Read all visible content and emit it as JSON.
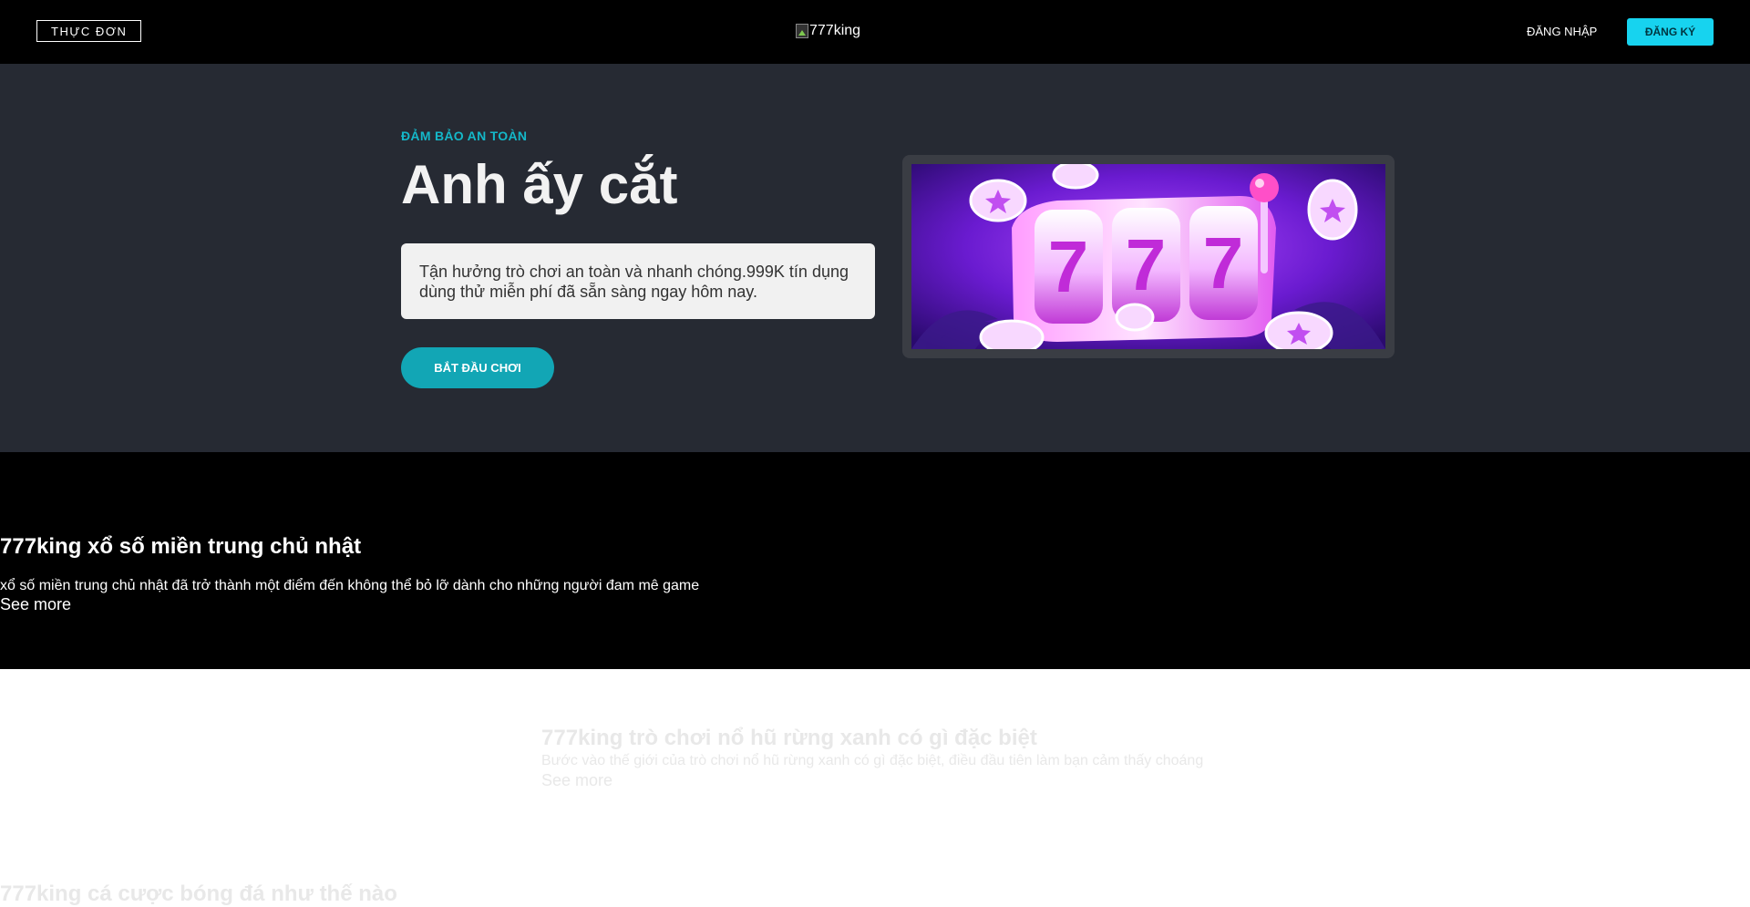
{
  "header": {
    "menu_label": "THỰC ĐƠN",
    "logo_alt": "777king",
    "login_label": "ĐĂNG NHẬP",
    "register_label": "ĐĂNG KÝ"
  },
  "hero": {
    "eyebrow": "ĐẢM BẢO AN TOÀN",
    "title": "Anh ấy cắt",
    "description": "Tận hưởng trò chơi an toàn và nhanh chóng.999K tín dụng dùng thử miễn phí đã sẵn sàng ngay hôm nay.",
    "cta_label": "BẮT ĐẦU CHƠI",
    "slot_digits": [
      "7",
      "7",
      "7"
    ]
  },
  "sections": {
    "lottery": {
      "title": "777king xổ số miền trung chủ nhật",
      "description": "xổ số miền trung chủ nhật đã trở thành một điểm đến không thể bỏ lỡ dành cho những người đam mê game",
      "see_more": "See more"
    },
    "forest": {
      "title": "777king trò chơi nổ hũ rừng xanh có gì đặc biệt",
      "description": "Bước vào thế giới của trò chơi nổ hũ rừng xanh có gì đặc biệt, điều đầu tiên làm bạn cảm thấy choáng",
      "see_more": "See more"
    },
    "football": {
      "title": "777king cá cược bóng đá như thế nào"
    }
  },
  "colors": {
    "accent": "#17d3ef",
    "cta": "#12a6b5",
    "hero_bg": "#262a33",
    "header_bg": "#000000"
  }
}
